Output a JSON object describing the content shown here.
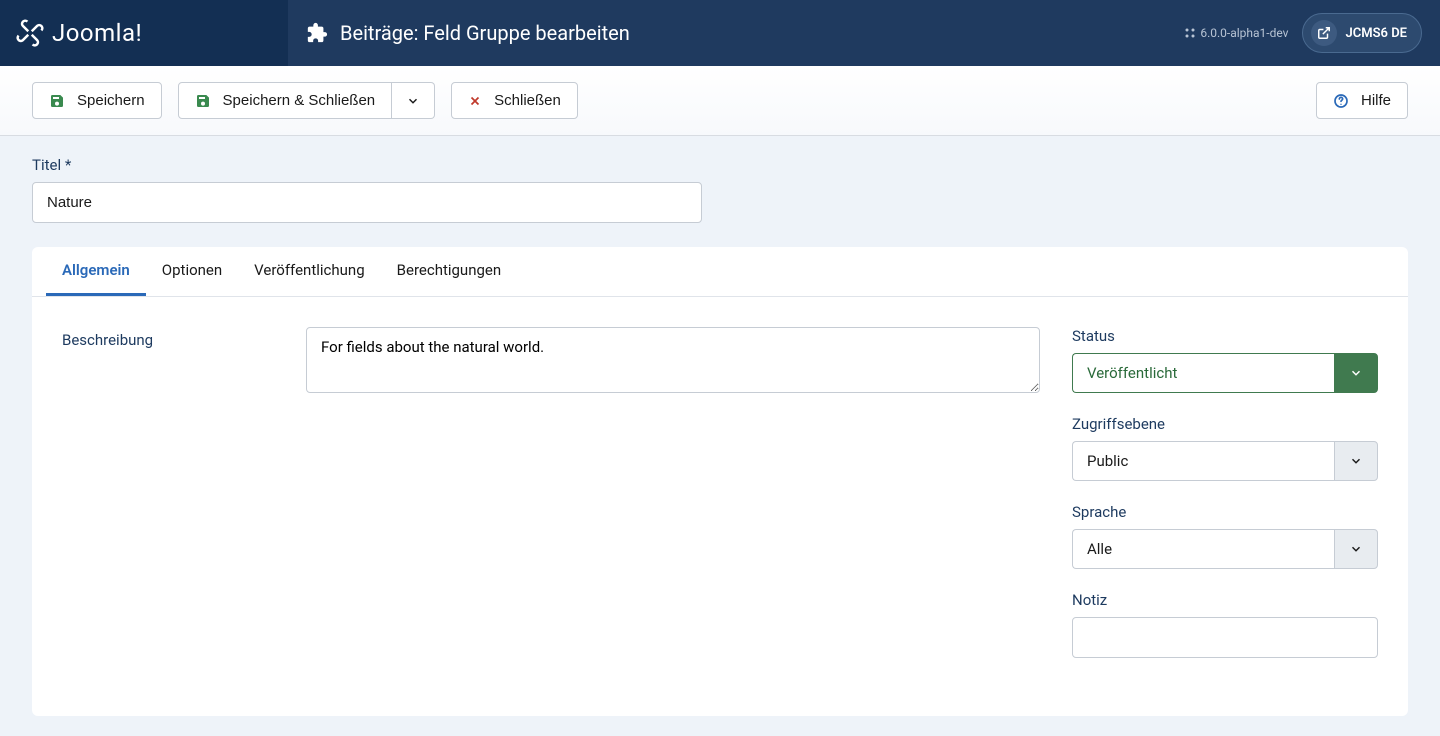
{
  "brand": {
    "name": "Joomla!"
  },
  "header": {
    "page_title": "Beiträge: Feld Gruppe bearbeiten",
    "version": "6.0.0-alpha1-dev",
    "site_name": "JCMS6 DE"
  },
  "toolbar": {
    "save": "Speichern",
    "save_close": "Speichern & Schließen",
    "close": "Schließen",
    "help": "Hilfe"
  },
  "form": {
    "title_label": "Titel *",
    "title_value": "Nature",
    "description_label": "Beschreibung",
    "description_value": "For fields about the natural world."
  },
  "tabs": {
    "general": "Allgemein",
    "options": "Optionen",
    "publishing": "Veröffentlichung",
    "permissions": "Berechtigungen"
  },
  "sidebar": {
    "status_label": "Status",
    "status_value": "Veröffentlicht",
    "access_label": "Zugriffsebene",
    "access_value": "Public",
    "language_label": "Sprache",
    "language_value": "Alle",
    "note_label": "Notiz",
    "note_value": ""
  }
}
